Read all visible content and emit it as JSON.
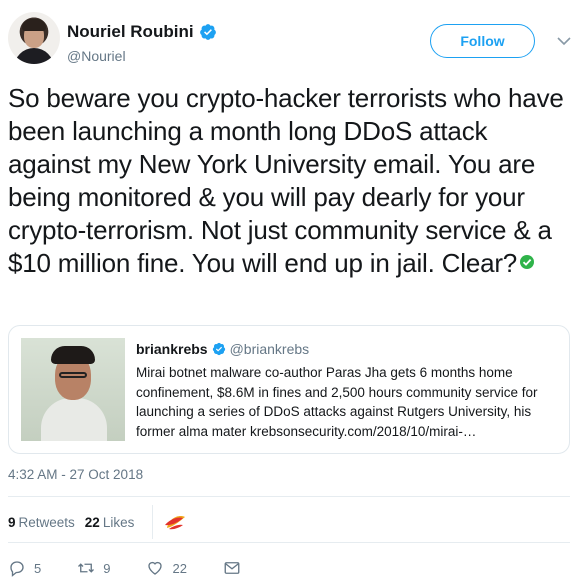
{
  "author": {
    "name": "Nouriel Roubini",
    "handle": "@Nouriel",
    "follow_label": "Follow"
  },
  "tweet": {
    "text": "So beware you crypto-hacker terrorists who have been launching a month long DDoS attack against my New York University email. You are being monitored & you will pay dearly for your crypto-terrorism. Not just community service & a $10 million fine. You will end up in jail. Clear?",
    "emoji": "check-mark-button-icon"
  },
  "quote": {
    "name": "briankrebs",
    "handle": "@briankrebs",
    "text": "Mirai botnet malware co-author Paras Jha gets 6 months home confinement, $8.6M in fines and 2,500 hours community service for launching a series of DDoS attacks against Rutgers University, his former alma mater krebsonsecurity.com/2018/10/mirai-…"
  },
  "timestamp": "4:32 AM - 27 Oct 2018",
  "stats": {
    "retweets_count": "9",
    "retweets_label": "Retweets",
    "likes_count": "22",
    "likes_label": "Likes"
  },
  "actions": {
    "replies": "5",
    "retweets": "9",
    "likes": "22"
  },
  "colors": {
    "accent": "#1da1f2",
    "text": "#14171a",
    "muted": "#657786",
    "verified_emoji": "#2fb34a"
  }
}
